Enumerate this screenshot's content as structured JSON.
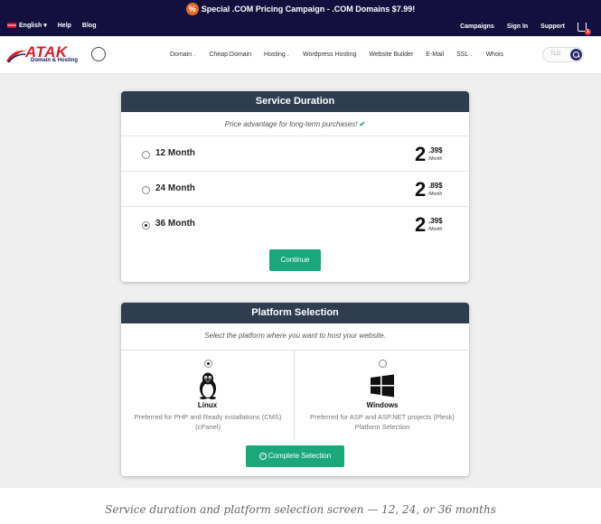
{
  "topbar": {
    "promo_text": "Special .COM Pricing Campaign - .COM Domains $7.99!",
    "language": "English",
    "help": "Help",
    "blog": "Blog",
    "campaigns": "Campaigns",
    "sign_in": "Sign In",
    "support": "Support",
    "cart_count": "1"
  },
  "header": {
    "logo_text": "ATAK",
    "logo_subtext": "Domain & Hosting",
    "nav": [
      {
        "label": "Domain",
        "has_caret": true
      },
      {
        "label": "Cheap Domain",
        "has_caret": false
      },
      {
        "label": "Hosting",
        "has_caret": true
      },
      {
        "label": "Wordpress Hosting",
        "has_caret": false
      },
      {
        "label": "Website Builder",
        "has_caret": false
      },
      {
        "label": "E-Mail",
        "has_caret": false
      },
      {
        "label": "SSL",
        "has_caret": true
      },
      {
        "label": "Whois",
        "has_caret": false
      }
    ],
    "search_placeholder": "TLD"
  },
  "service_duration": {
    "title": "Service Duration",
    "subtitle": "Price advantage for long-term purchases!",
    "options": [
      {
        "label": "12 Month",
        "price_whole": "2",
        "price_cents": ".39$",
        "per": "/Month",
        "selected": false
      },
      {
        "label": "24 Month",
        "price_whole": "2",
        "price_cents": ".89$",
        "per": "/Month",
        "selected": false
      },
      {
        "label": "36 Month",
        "price_whole": "2",
        "price_cents": ".39$",
        "per": "/Month",
        "selected": true
      }
    ],
    "continue_label": "Continue"
  },
  "platform_selection": {
    "title": "Platform Selection",
    "subtitle": "Select the platform where you want to host your website.",
    "platforms": [
      {
        "name": "Linux",
        "description": "Preferred for PHP and Ready installations (CMS) (cPanel)",
        "selected": true,
        "icon": "linux-tux-icon"
      },
      {
        "name": "Windows",
        "description": "Preferred for ASP and ASP.NET projects (Plesk) Platform Selection",
        "selected": false,
        "icon": "windows-logo-icon"
      }
    ],
    "complete_label": "Complete Selection"
  },
  "caption": "Service duration and platform selection screen — 12, 24, or 36 months",
  "colors": {
    "topbar_bg": "#13103f",
    "card_header_bg": "#2e3e50",
    "button_green": "#1aa77a",
    "brand_red": "#d3202a"
  }
}
